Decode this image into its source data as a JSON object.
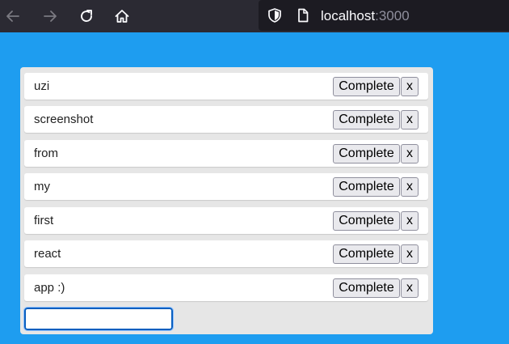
{
  "browser": {
    "url_host": "localhost",
    "url_port": ":3000",
    "icons": {
      "back": "arrow-left-icon",
      "forward": "arrow-right-icon",
      "reload": "reload-icon",
      "home": "home-icon",
      "shield": "shield-icon",
      "page": "page-icon"
    }
  },
  "colors": {
    "page_background": "#1e9df0",
    "panel_background": "#e6e6e6",
    "row_background": "#ffffff",
    "toolbar_background": "#2b2a33",
    "urlbar_background": "#1c1b22"
  },
  "todos": [
    {
      "text": "uzi",
      "complete_label": "Complete",
      "remove_label": "x"
    },
    {
      "text": "screenshot",
      "complete_label": "Complete",
      "remove_label": "x"
    },
    {
      "text": "from",
      "complete_label": "Complete",
      "remove_label": "x"
    },
    {
      "text": "my",
      "complete_label": "Complete",
      "remove_label": "x"
    },
    {
      "text": "first",
      "complete_label": "Complete",
      "remove_label": "x"
    },
    {
      "text": "react",
      "complete_label": "Complete",
      "remove_label": "x"
    },
    {
      "text": "app :)",
      "complete_label": "Complete",
      "remove_label": "x"
    }
  ],
  "new_todo": {
    "value": "",
    "placeholder": ""
  }
}
